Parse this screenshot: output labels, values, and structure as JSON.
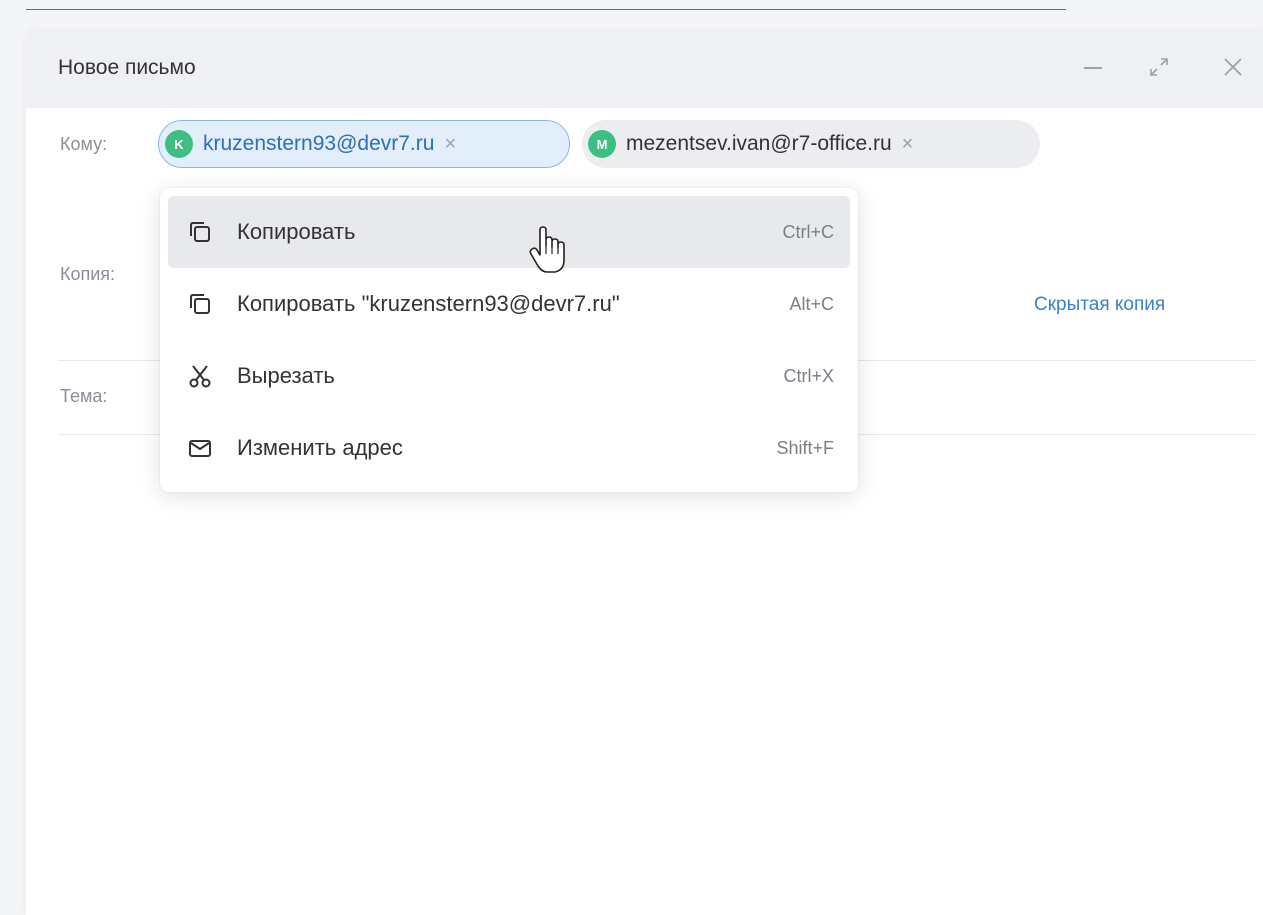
{
  "compose": {
    "title": "Новое письмо",
    "to_label": "Кому:",
    "cc_label": "Копия:",
    "bcc_link": "Скрытая копия",
    "subject_label": "Тема:",
    "recipients": [
      {
        "initial": "K",
        "email": "kruzenstern93@devr7.ru",
        "state": "selected"
      },
      {
        "initial": "M",
        "email": "mezentsev.ivan@r7-office.ru",
        "state": "normal"
      }
    ]
  },
  "window_controls": {
    "minimize": "minimize-icon",
    "expand": "expand-icon",
    "close": "close-icon"
  },
  "context_menu": {
    "items": [
      {
        "label": "Копировать",
        "shortcut": "Ctrl+C",
        "icon": "copy-icon",
        "hovered": true
      },
      {
        "label": "Копировать \"kruzenstern93@devr7.ru\"",
        "shortcut": "Alt+C",
        "icon": "copy-icon",
        "hovered": false
      },
      {
        "label": "Вырезать",
        "shortcut": "Ctrl+X",
        "icon": "scissors-icon",
        "hovered": false
      },
      {
        "label": "Изменить адрес",
        "shortcut": "Shift+F",
        "icon": "mail-icon",
        "hovered": false
      }
    ]
  },
  "colors": {
    "accent": "#3b82c4",
    "avatar": "#3dbf83",
    "selected_chip_bg": "#e3eefb",
    "header_bg": "#eef0f4"
  }
}
